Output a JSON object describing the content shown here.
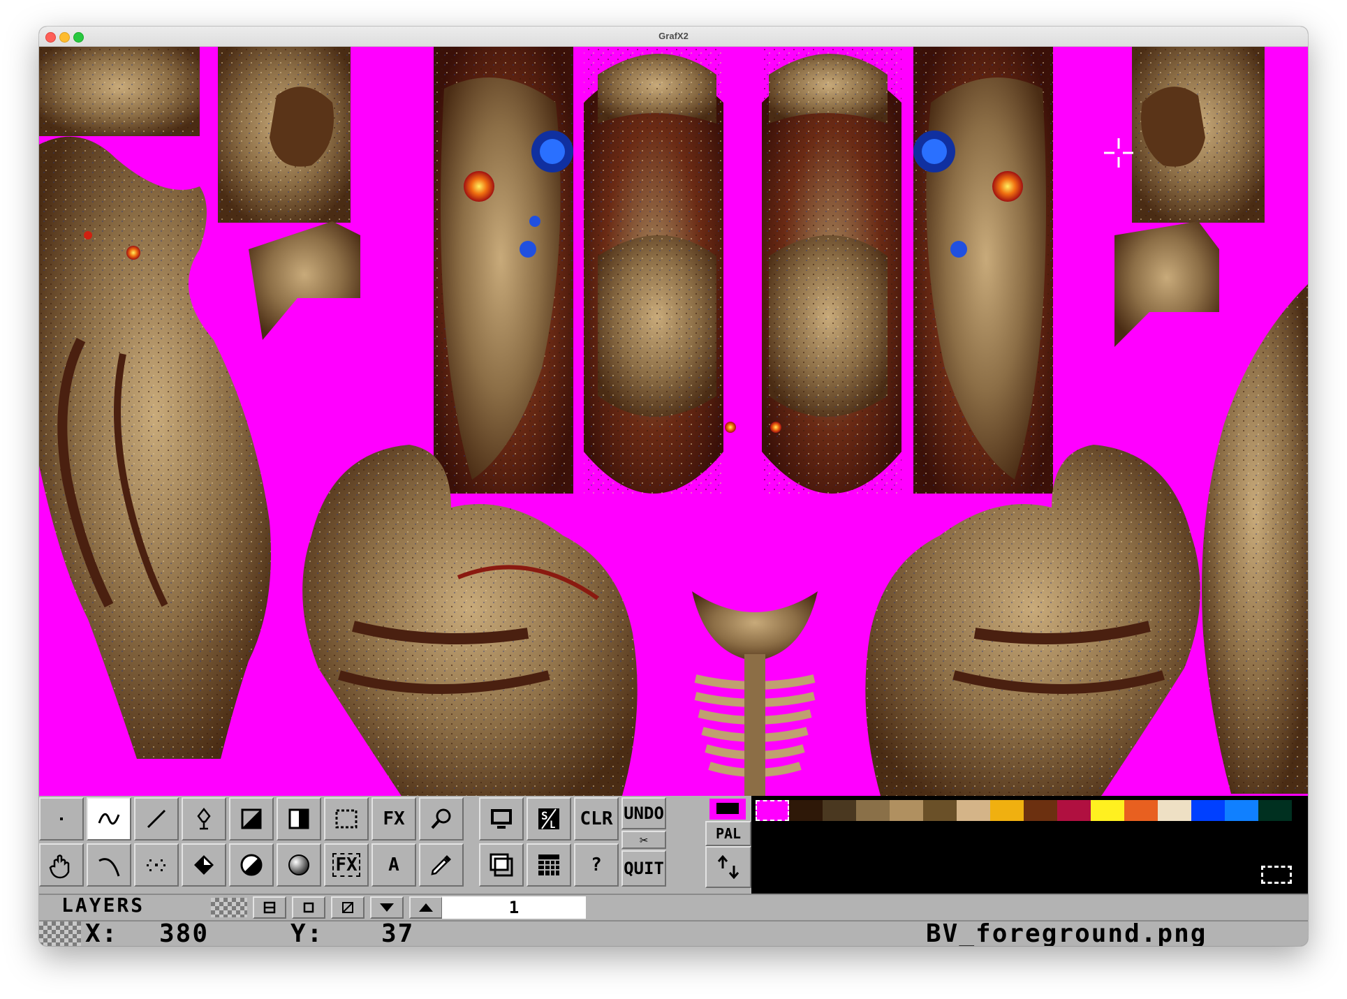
{
  "window": {
    "title": "GrafX2"
  },
  "canvas": {
    "background": "#ff00ff"
  },
  "tools": {
    "row1": [
      {
        "name": "dot-draw-icon",
        "label": ""
      },
      {
        "name": "freehand-draw-icon",
        "label": ""
      },
      {
        "name": "line-tool-icon",
        "label": ""
      },
      {
        "name": "spray-airbrush-icon",
        "label": ""
      },
      {
        "name": "filled-rect-icon",
        "label": ""
      },
      {
        "name": "gradient-rect-icon",
        "label": ""
      },
      {
        "name": "brush-grab-icon",
        "label": ""
      },
      {
        "name": "fx-button",
        "label": "FX"
      },
      {
        "name": "magnifier-icon",
        "label": ""
      },
      {
        "name": "monitor-icon",
        "label": ""
      },
      {
        "name": "save-load-icon",
        "label": ""
      },
      {
        "name": "clear-button",
        "label": "CLR"
      },
      {
        "name": "undo-button",
        "label": "UNDO"
      }
    ],
    "row2": [
      {
        "name": "hand-pan-icon",
        "label": ""
      },
      {
        "name": "curve-tool-icon",
        "label": ""
      },
      {
        "name": "polygon-tool-icon",
        "label": ""
      },
      {
        "name": "fill-bucket-icon",
        "label": ""
      },
      {
        "name": "circle-tool-icon",
        "label": ""
      },
      {
        "name": "sphere-tool-icon",
        "label": ""
      },
      {
        "name": "brush-fx-button",
        "label": "FX"
      },
      {
        "name": "text-tool-button",
        "label": "A"
      },
      {
        "name": "color-picker-icon",
        "label": ""
      },
      {
        "name": "windows-icon",
        "label": ""
      },
      {
        "name": "grid-settings-icon",
        "label": ""
      },
      {
        "name": "help-button",
        "label": "?"
      },
      {
        "name": "quit-button",
        "label": "QUIT"
      }
    ],
    "kill_glyph": "✂",
    "pal_label": "PAL"
  },
  "palette": {
    "colors": [
      "#ff00ff",
      "#2e1808",
      "#4a3820",
      "#8a7048",
      "#b09060",
      "#6a5028",
      "#d4b488",
      "#f0b010",
      "#6c3010",
      "#b01040",
      "#fff020",
      "#e86020",
      "#eee0c4",
      "#0040ff",
      "#1080ff",
      "#003020"
    ],
    "fg": "#000000",
    "bg": "#ff00ff"
  },
  "layers": {
    "label": "LAYERS",
    "current": "1"
  },
  "status": {
    "x_label": "X:",
    "x_value": "380",
    "y_label": "Y:",
    "y_value": "37",
    "filename": "BV_foreground.png"
  }
}
